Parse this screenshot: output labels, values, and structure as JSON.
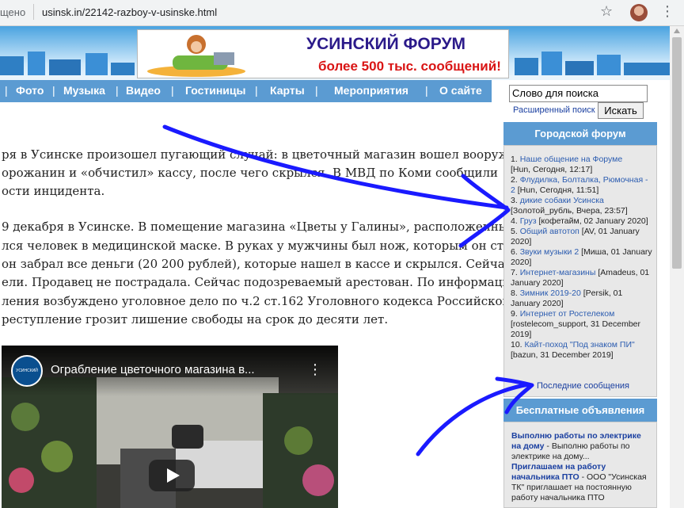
{
  "browser": {
    "secure_label": "щено",
    "url": "usinsk.in/22142-razboy-v-usinske.html",
    "star_icon": "bookmark-star-icon",
    "menu_icon": "kebab-menu-icon"
  },
  "header": {
    "banner_title": "УСИНСКИЙ ФОРУМ",
    "banner_subtitle": "более 500 тыс. сообщений!"
  },
  "nav": {
    "divider": "|",
    "items": [
      "Фото",
      "Музыка",
      "Видео",
      "Гостиницы",
      "Карты",
      "Мероприятия",
      "О сайте"
    ]
  },
  "article": {
    "lines": [
      "ря в Усинске произошел пугающий случай: в цветочный магазин вошел вооруженный",
      "орожанин и «обчистил» кассу, после чего скрылся. В МВД по Коми сообщили",
      "ости инцидента.",
      "9 декабря в Усинске. В помещение магазина «Цветы у Галины», расположенный по",
      "лся человек в медицинской маске. В руках у мужчины был нож, которым он стал",
      "он забрал все деньги (20 200 рублей), которые нашел в кассе и скрылся. Сейчас делом",
      "ели. Продавец не пострадала. Сейчас подозреваемый арестован. По информации",
      "ления возбуждено уголовное дело по ч.2 ст.162 Уголовного кодекса Российской",
      "реступление грозит лишение свободы на срок до десяти лет."
    ]
  },
  "video": {
    "title": "Ограбление цветочного магазина в...",
    "channel_logo_text": "УСИНСКИЙ",
    "menu_glyph": "⋮"
  },
  "sidebar": {
    "search_value": "Слово для поиска",
    "advanced_search": "Расширенный поиск",
    "search_button": "Искать",
    "forum_header": "Городской форум",
    "forum_items": [
      {
        "num": "1.",
        "title": "Наше общение на Форуме",
        "meta": "[Hun, Сегодня, 12:17]"
      },
      {
        "num": "2.",
        "title": "Флудилка, Болталка, Рюмочная - 2",
        "meta": "[Hun, Сегодня, 11:51]"
      },
      {
        "num": "3.",
        "title": "дикие собаки Усинска",
        "meta": "[Золотой_рубль, Вчера, 23:57]"
      },
      {
        "num": "4.",
        "title": "Груз",
        "meta": "[кофетайм, 02 January 2020]"
      },
      {
        "num": "5.",
        "title": "Общий автотоп",
        "meta": "[AV, 01 January 2020]"
      },
      {
        "num": "6.",
        "title": "Звуки музыки 2",
        "meta": "[Миша, 01 January 2020]"
      },
      {
        "num": "7.",
        "title": "Интернет-магазины",
        "meta": "[Amadeus, 01 January 2020]"
      },
      {
        "num": "8.",
        "title": "Зимник 2019-20",
        "meta": "[Persik, 01 January 2020]"
      },
      {
        "num": "9.",
        "title": "Интернет от Ростелеком",
        "meta": "[rostelecom_support, 31 December 2019]"
      },
      {
        "num": "10.",
        "title": "Кайт-поход \"Под знаком ПИ\"",
        "meta": "[bazun, 31 December 2019]"
      }
    ],
    "last_messages": "Последние сообщения",
    "ads_header": "Бесплатные объявления",
    "ads": [
      {
        "title": "Выполню работы по электрике на дому",
        "text": " - Выполню работы по электрике на дому..."
      },
      {
        "title": "Приглашаем на работу начальника ПТО",
        "text": " - ООО \"Усинская ТК\" приглашает на постоянную работу начальника ПТО"
      }
    ]
  },
  "colors": {
    "nav_bg": "#5b9bd2",
    "link": "#2b5cb0",
    "annotation": "#1a1aff",
    "banner_title": "#2b1a8a",
    "banner_subtitle": "#d91414"
  }
}
